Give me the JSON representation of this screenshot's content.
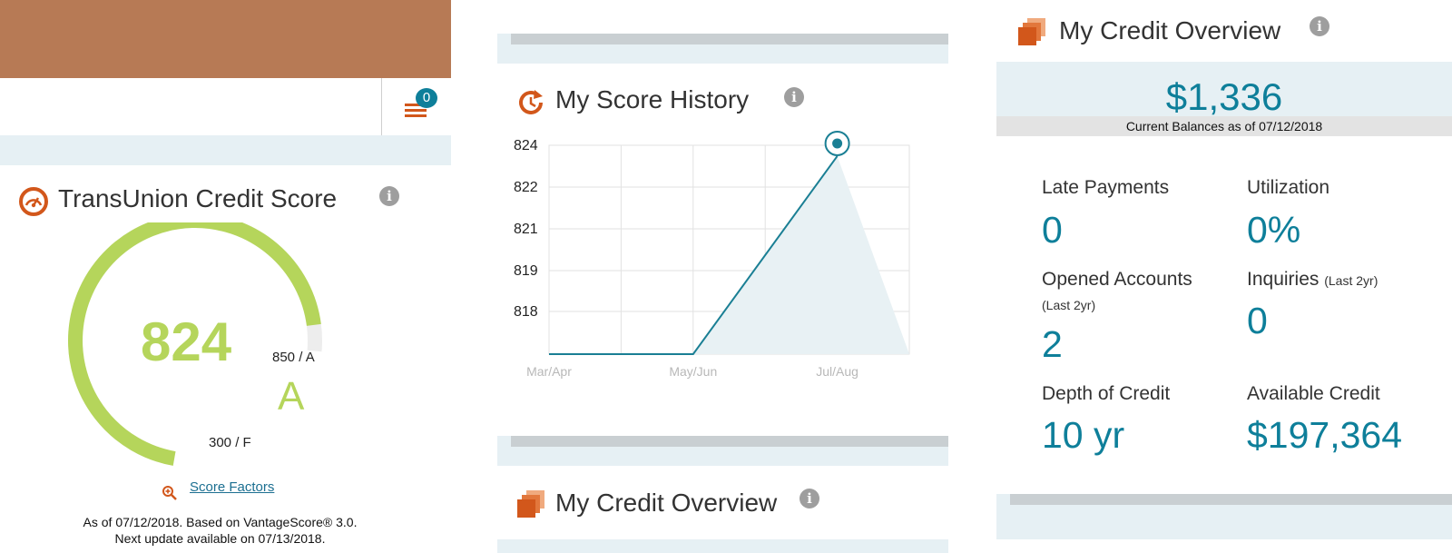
{
  "header": {
    "notification_count": "0"
  },
  "credit_score": {
    "title": "TransUnion Credit Score",
    "score": "824",
    "grade": "A",
    "max_label": "850 / A",
    "min_label": "300 / F",
    "score_factors_link": "Score Factors",
    "footnote_line1": "As of 07/12/2018. Based on VantageScore® 3.0.",
    "footnote_line2": "Next update available on 07/13/2018.",
    "gauge_fraction": 0.953
  },
  "score_history": {
    "title": "My Score History"
  },
  "chart_data": {
    "type": "line",
    "categories": [
      "Mar/Apr",
      "May/Jun",
      "Jul/Aug"
    ],
    "y_ticks": [
      "824",
      "822",
      "821",
      "819",
      "818"
    ],
    "ylim": [
      816.3,
      824
    ],
    "series": [
      {
        "x": [
          "Mar/Apr",
          "May/Jun",
          "Jul/Aug"
        ],
        "values": [
          816.3,
          816.3,
          823.6
        ]
      }
    ],
    "highlighted_point": "Jul/Aug",
    "grid": true
  },
  "overview_small": {
    "title": "My Credit Overview"
  },
  "overview": {
    "title": "My Credit Overview",
    "balance": "$1,336",
    "balance_caption": "Current Balances as of 07/12/2018",
    "late_payments_label": "Late Payments",
    "late_payments_value": "0",
    "utilization_label": "Utilization",
    "utilization_value": "0%",
    "opened_accounts_label": "Opened Accounts",
    "opened_accounts_sub": "(Last 2yr)",
    "opened_accounts_value": "2",
    "inquiries_label": "Inquiries",
    "inquiries_sub": "(Last 2yr)",
    "inquiries_value": "0",
    "depth_label": "Depth of Credit",
    "depth_value": "10 yr",
    "available_label": "Available Credit",
    "available_value": "$197,364"
  },
  "colors": {
    "brand_orange": "#d2571b",
    "header_brown": "#b77a55",
    "gauge_green": "#b5d55b",
    "teal": "#0e7f9a",
    "light_blue_band": "#e6f0f4"
  }
}
